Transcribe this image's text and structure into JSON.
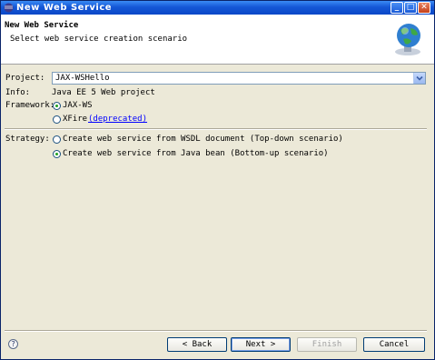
{
  "window": {
    "title": "New Web Service",
    "min_label": "_",
    "max_label": "□",
    "close_label": "✕"
  },
  "banner": {
    "title": "New Web Service",
    "description": "Select web service creation scenario",
    "image_icon": "globe-icon"
  },
  "form": {
    "project_label": "Project:",
    "project_value": "JAX-WSHello",
    "info_label": "Info:",
    "info_value": "Java EE 5 Web project",
    "framework_label": "Framework:",
    "frameworks": [
      {
        "label": "JAX-WS",
        "checked": true
      },
      {
        "label": "XFire",
        "extra": "(deprecated)",
        "checked": false
      }
    ],
    "strategy_label": "Strategy:",
    "strategies": [
      {
        "label": "Create web service from WSDL document (Top-down scenario)",
        "checked": false
      },
      {
        "label": "Create web service from Java bean (Bottom-up scenario)",
        "checked": true
      }
    ]
  },
  "buttons": {
    "help": "?",
    "back": "< Back",
    "next": "Next >",
    "finish": "Finish",
    "cancel": "Cancel"
  },
  "colors": {
    "titlebar": "#0a48c8",
    "link": "#0000ff",
    "radio_dot": "#21a121"
  }
}
